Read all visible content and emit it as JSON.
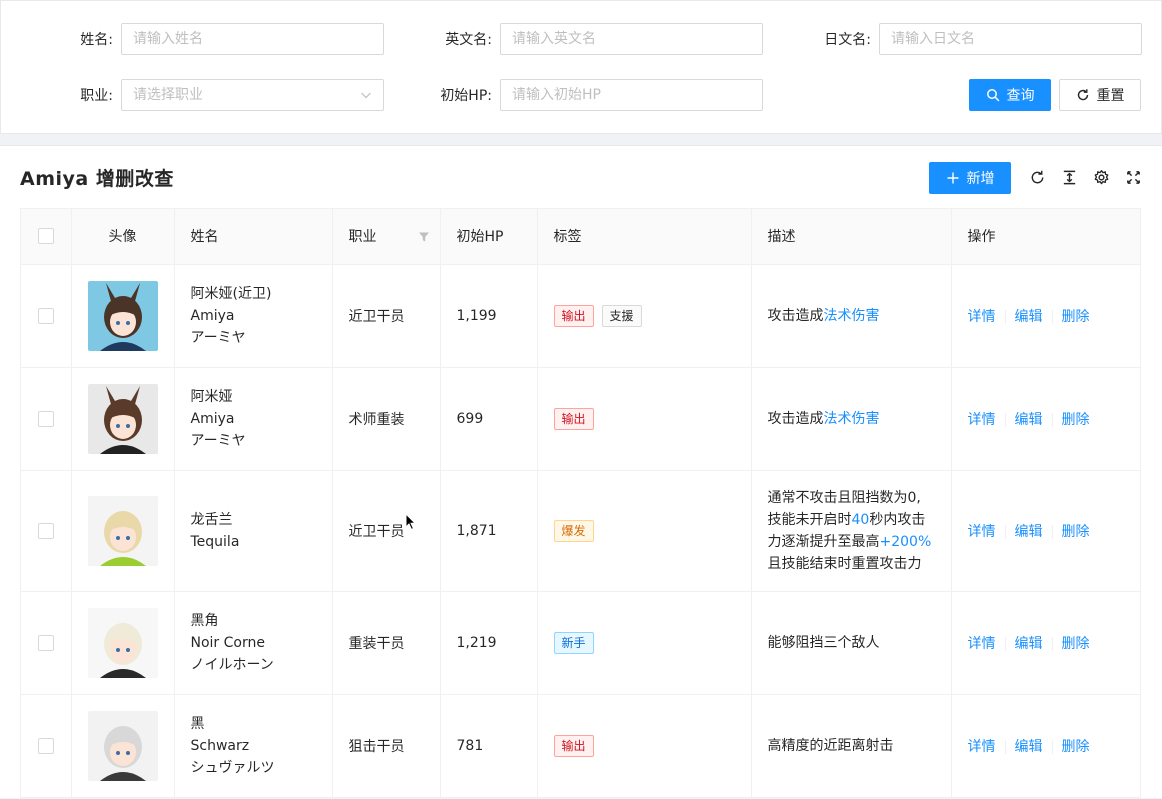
{
  "search": {
    "name_label": "姓名:",
    "name_placeholder": "请输入姓名",
    "en_label": "英文名:",
    "en_placeholder": "请输入英文名",
    "jp_label": "日文名:",
    "jp_placeholder": "请输入日文名",
    "class_label": "职业:",
    "class_placeholder": "请选择职业",
    "hp_label": "初始HP:",
    "hp_placeholder": "请输入初始HP",
    "query_label": "查询",
    "reset_label": "重置"
  },
  "card": {
    "title": "Amiya 增删改查",
    "add_label": "新增"
  },
  "colors": {
    "primary": "#1890ff",
    "tag_red": "#cf1322",
    "tag_orange": "#d46b08",
    "tag_blue": "#096dd9"
  },
  "table": {
    "columns": [
      "头像",
      "姓名",
      "职业",
      "初始HP",
      "标签",
      "描述",
      "操作"
    ],
    "actions": [
      "详情",
      "编辑",
      "删除"
    ],
    "rows": [
      {
        "names": [
          "阿米娅(近卫)",
          "Amiya",
          "アーミヤ"
        ],
        "class": "近卫干员",
        "hp": "1,199",
        "tags": [
          {
            "text": "输出",
            "color": "red"
          },
          {
            "text": "支援",
            "color": "default"
          }
        ],
        "desc": [
          {
            "t": "攻击造成"
          },
          {
            "t": "法术伤害",
            "hl": true
          }
        ]
      },
      {
        "names": [
          "阿米娅",
          "Amiya",
          "アーミヤ"
        ],
        "class": "术师重装",
        "hp": "699",
        "tags": [
          {
            "text": "输出",
            "color": "red"
          }
        ],
        "desc": [
          {
            "t": "攻击造成"
          },
          {
            "t": "法术伤害",
            "hl": true
          }
        ]
      },
      {
        "names": [
          "龙舌兰",
          "Tequila"
        ],
        "class": "近卫干员",
        "hp": "1,871",
        "tags": [
          {
            "text": "爆发",
            "color": "orange"
          }
        ],
        "desc_lines": [
          [
            {
              "t": "通常不攻击且阻挡数为0,"
            }
          ],
          [
            {
              "t": "技能未开启时"
            },
            {
              "t": "40",
              "hl": true
            },
            {
              "t": "秒内攻击"
            }
          ],
          [
            {
              "t": "力逐渐提升至最高"
            },
            {
              "t": "+200%",
              "hl": true
            }
          ],
          [
            {
              "t": "且技能结束时重置攻击力"
            }
          ]
        ]
      },
      {
        "names": [
          "黑角",
          "Noir Corne",
          "ノイルホーン"
        ],
        "class": "重装干员",
        "hp": "1,219",
        "tags": [
          {
            "text": "新手",
            "color": "blue"
          }
        ],
        "desc": [
          {
            "t": "能够阻挡三个敌人"
          }
        ]
      },
      {
        "names": [
          "黑",
          "Schwarz",
          "シュヴァルツ"
        ],
        "class": "狙击干员",
        "hp": "781",
        "tags": [
          {
            "text": "输出",
            "color": "red"
          }
        ],
        "desc": [
          {
            "t": "高精度的近距离射击"
          }
        ]
      }
    ]
  }
}
